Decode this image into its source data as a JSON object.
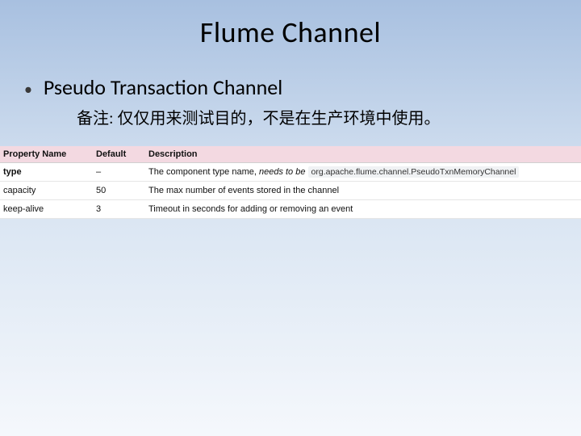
{
  "title": "Flume Channel",
  "subtitle": "Pseudo Transaction Channel",
  "note": "备注: 仅仅用来测试目的，不是在生产环境中使用。",
  "table": {
    "headers": {
      "name": "Property Name",
      "default": "Default",
      "desc": "Description"
    },
    "rows": [
      {
        "name": "type",
        "default": "–",
        "desc_prefix": "The component type name, ",
        "desc_italic": "needs to be",
        "desc_suffix": " ",
        "code": "org.apache.flume.channel.PseudoTxnMemoryChannel",
        "bold": true
      },
      {
        "name": "capacity",
        "default": "50",
        "desc": "The max number of events stored in the channel"
      },
      {
        "name": "keep-alive",
        "default": "3",
        "desc": "Timeout in seconds for adding or removing an event"
      }
    ]
  }
}
